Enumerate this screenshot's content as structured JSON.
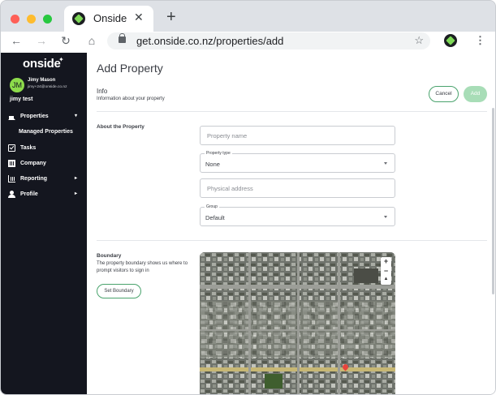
{
  "browser": {
    "tab_title": "Onside",
    "tab_close_glyph": "✕",
    "new_tab_glyph": "+",
    "url": "get.onside.co.nz/properties/add",
    "back_glyph": "←",
    "forward_glyph": "→",
    "reload_glyph": "↻",
    "home_glyph": "⌂",
    "star_glyph": "☆",
    "menu_glyph": "⋮"
  },
  "sidebar": {
    "logo": "onside",
    "logo_spark": "✦",
    "user": {
      "initials": "JM",
      "name": "Jimy Mason",
      "email": "jimy+24@onside.co.nz",
      "org": "jimy test"
    },
    "items": [
      {
        "label": "Properties",
        "icon": "home-icon",
        "expanded": true,
        "chevron": "▾"
      },
      {
        "label": "Tasks",
        "icon": "checkbox-icon"
      },
      {
        "label": "Company",
        "icon": "building-icon"
      },
      {
        "label": "Reporting",
        "icon": "chart-icon",
        "chevron": "▸"
      },
      {
        "label": "Profile",
        "icon": "person-icon",
        "chevron": "▸"
      }
    ],
    "subitems": [
      {
        "label": "Managed Properties"
      }
    ]
  },
  "main": {
    "title": "Add Property",
    "info_title": "Info",
    "info_subtitle": "Information about your property",
    "cancel_label": "Cancel",
    "add_label": "Add",
    "about_label": "About the Property",
    "fields": {
      "property_name": {
        "placeholder": "Property name",
        "value": ""
      },
      "property_type": {
        "label": "Property type",
        "value": "None"
      },
      "physical_address": {
        "placeholder": "Physical address",
        "value": ""
      },
      "group": {
        "label": "Group",
        "value": "Default"
      }
    },
    "boundary": {
      "title": "Boundary",
      "description": "The property boundary shows us where to prompt visitors to sign in",
      "button_label": "Set Boundary"
    },
    "map": {
      "zoom_in": "+",
      "zoom_out": "−",
      "compass": "▲"
    }
  },
  "colors": {
    "sidebar_bg": "#14161f",
    "accent_green": "#4aa36d",
    "add_button_disabled": "#a8ddb7",
    "avatar": "#8ddb4b"
  }
}
